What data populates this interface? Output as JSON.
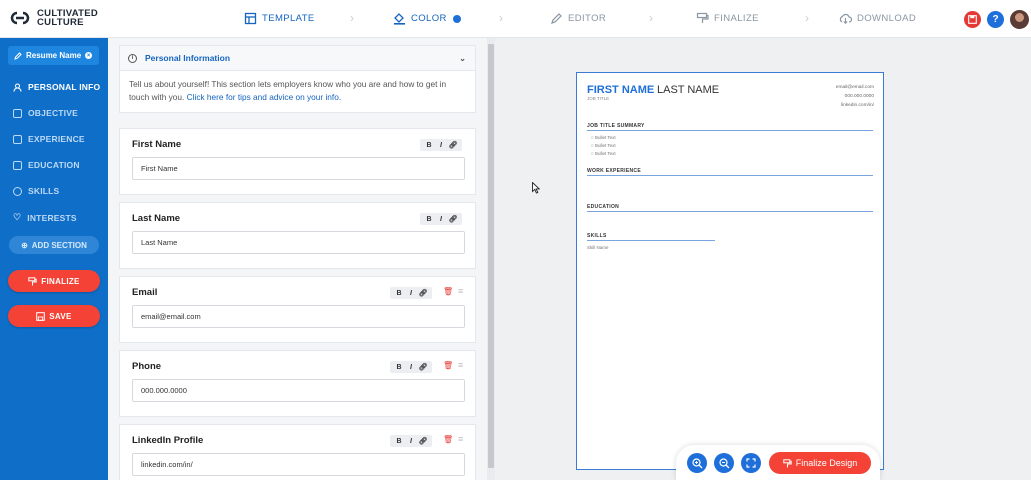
{
  "app": {
    "logo_line1": "CULTIVATED",
    "logo_line2": "CULTURE"
  },
  "steps": [
    {
      "label": "TEMPLATE",
      "icon": "layout-icon",
      "active": false
    },
    {
      "label": "COLOR",
      "icon": "paint-bucket-icon",
      "active": true
    },
    {
      "label": "EDITOR",
      "icon": "pencil-icon",
      "active": false
    },
    {
      "label": "FINALIZE",
      "icon": "paint-roller-icon",
      "active": false
    },
    {
      "label": "DOWNLOAD",
      "icon": "cloud-download-icon",
      "active": false
    }
  ],
  "sidebar": {
    "resume_name": "Resume Name",
    "items": [
      {
        "label": "PERSONAL INFO",
        "icon": "person-icon",
        "active": true
      },
      {
        "label": "OBJECTIVE",
        "icon": "objective-icon",
        "active": false
      },
      {
        "label": "EXPERIENCE",
        "icon": "briefcase-icon",
        "active": false
      },
      {
        "label": "EDUCATION",
        "icon": "education-icon",
        "active": false
      },
      {
        "label": "SKILLS",
        "icon": "skills-icon",
        "active": false
      },
      {
        "label": "INTERESTS",
        "icon": "heart-icon",
        "active": false
      }
    ],
    "add_section": "ADD SECTION",
    "finalize": "FINALIZE",
    "save": "SAVE"
  },
  "form": {
    "section_title": "Personal Information",
    "intro_text": "Tell us about yourself! This section lets employers know who you are and how to get in touch with you.",
    "intro_link": "Click here for tips and advice on your info.",
    "fields": [
      {
        "label": "First Name",
        "value": "First Name"
      },
      {
        "label": "Last Name",
        "value": "Last Name"
      },
      {
        "label": "Email",
        "value": "email@email.com"
      },
      {
        "label": "Phone",
        "value": "000.000.0000"
      },
      {
        "label": "LinkedIn Profile",
        "value": "linkedin.com/in/"
      }
    ],
    "format_bold": "B",
    "format_italic": "I"
  },
  "resume_preview": {
    "first_name": "FIRST NAME",
    "last_name": "LAST NAME",
    "job_title": "JOB TITLE",
    "email": "email@email.com",
    "phone": "000.000.0000",
    "linkedin": "linkedin.com/in/",
    "sections": {
      "summary": "JOB TITLE SUMMARY",
      "work": "WORK EXPERIENCE",
      "education": "EDUCATION",
      "skills": "SKILLS"
    },
    "bullets": [
      "Bullet Text",
      "Bullet Text",
      "Bullet Text"
    ],
    "skill_name": "Skill Name"
  },
  "zoom_toolbar": {
    "finalize_design": "Finalize Design"
  },
  "colors": {
    "primary": "#0f6ec7",
    "accent_red": "#f44336",
    "link_blue": "#1565c0"
  }
}
